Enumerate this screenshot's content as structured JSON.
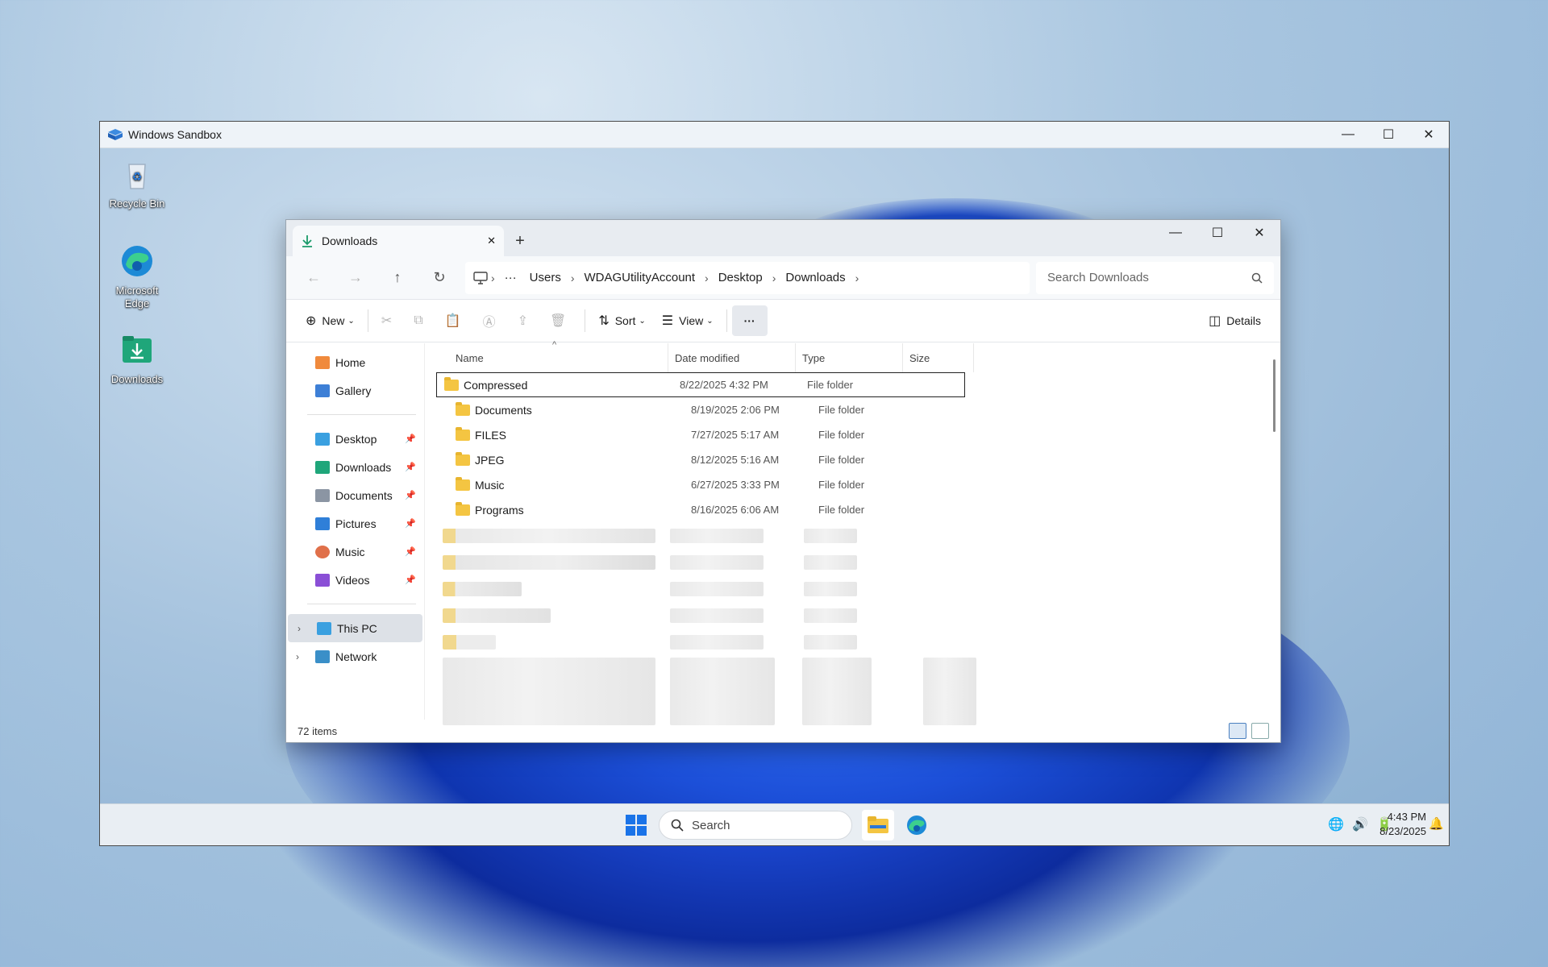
{
  "sandbox": {
    "title": "Windows Sandbox",
    "controls": {
      "minimize": "—",
      "maximize": "☐",
      "close": "✕"
    }
  },
  "desktop_icons": [
    {
      "label": "Recycle Bin",
      "icon": "recycle-bin-icon"
    },
    {
      "label": "Microsoft Edge",
      "icon": "edge-icon"
    },
    {
      "label": "Downloads",
      "icon": "downloads-folder-icon"
    }
  ],
  "explorer": {
    "tab": {
      "title": "Downloads",
      "close": "✕",
      "new_tab": "+"
    },
    "controls": {
      "minimize": "—",
      "maximize": "☐",
      "close": "✕"
    },
    "nav": {
      "back": "←",
      "forward": "→",
      "up": "↑",
      "refresh": "↻"
    },
    "address": {
      "more": "···",
      "segments": [
        "Users",
        "WDAGUtilityAccount",
        "Desktop",
        "Downloads"
      ]
    },
    "search_placeholder": "Search Downloads",
    "commands": {
      "new": "New",
      "sort": "Sort",
      "view": "View",
      "more": "···",
      "details": "Details"
    },
    "sidebar": {
      "top": [
        {
          "label": "Home",
          "icon": "home-icon"
        },
        {
          "label": "Gallery",
          "icon": "gallery-icon"
        }
      ],
      "quick_access": [
        {
          "label": "Desktop",
          "icon": "desktop-icon"
        },
        {
          "label": "Downloads",
          "icon": "downloads-icon"
        },
        {
          "label": "Documents",
          "icon": "documents-icon"
        },
        {
          "label": "Pictures",
          "icon": "pictures-icon"
        },
        {
          "label": "Music",
          "icon": "music-icon"
        },
        {
          "label": "Videos",
          "icon": "videos-icon"
        }
      ],
      "drives": [
        {
          "label": "This PC",
          "icon": "this-pc-icon",
          "selected": true
        },
        {
          "label": "Network",
          "icon": "network-icon",
          "selected": false
        }
      ]
    },
    "columns": [
      "Name",
      "Date modified",
      "Type",
      "Size"
    ],
    "files": [
      {
        "name": "Compressed",
        "date": "8/22/2025 4:32 PM",
        "type": "File folder"
      },
      {
        "name": "Documents",
        "date": "8/19/2025 2:06 PM",
        "type": "File folder"
      },
      {
        "name": "FILES",
        "date": "7/27/2025 5:17 AM",
        "type": "File folder"
      },
      {
        "name": "JPEG",
        "date": "8/12/2025 5:16 AM",
        "type": "File folder"
      },
      {
        "name": "Music",
        "date": "6/27/2025 3:33 PM",
        "type": "File folder"
      },
      {
        "name": "Programs",
        "date": "8/16/2025 6:06 AM",
        "type": "File folder"
      }
    ],
    "status": "72 items"
  },
  "taskbar": {
    "search_label": "Search",
    "time": "4:43 PM",
    "date": "8/23/2025"
  },
  "colors": {
    "accent": "#1a73e8",
    "folder": "#f4c542",
    "wallpaper_blue": "#1c4fd8"
  }
}
